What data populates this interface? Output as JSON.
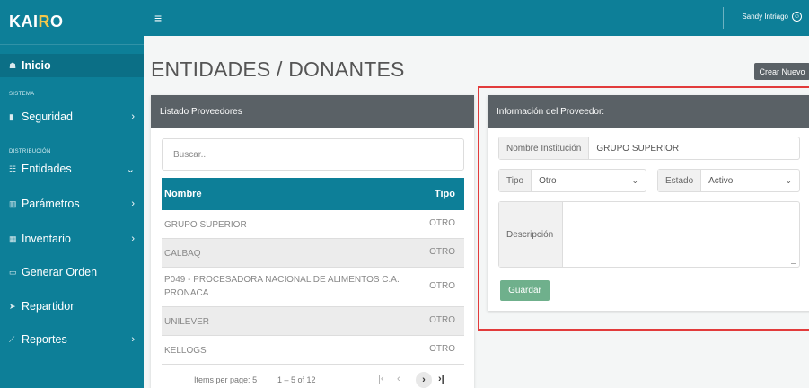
{
  "brand": {
    "prefix": "KAI",
    "accent": "R",
    "suffix": "O"
  },
  "sidebar": {
    "home": "Inicio",
    "sections": [
      "SISTEMA",
      "DISTRIBUCIÓN"
    ],
    "items": [
      {
        "label": "Seguridad",
        "icon": "lock-icon"
      },
      {
        "label": "Entidades",
        "icon": "list-icon"
      },
      {
        "label": "Parámetros",
        "icon": "chart-icon"
      },
      {
        "label": "Inventario",
        "icon": "grid-icon"
      },
      {
        "label": "Generar Orden",
        "icon": "cart-icon"
      },
      {
        "label": "Repartidor",
        "icon": "send-icon"
      },
      {
        "label": "Reportes",
        "icon": "trend-icon"
      }
    ]
  },
  "topbar": {
    "user": "Sandy Intriago"
  },
  "page": {
    "title": "ENTIDADES / DONANTES",
    "create_button": "Crear Nuevo"
  },
  "list": {
    "title": "Listado Proveedores",
    "search_placeholder": "Buscar...",
    "columns": [
      "Nombre",
      "Tipo"
    ],
    "rows": [
      {
        "nombre": "GRUPO SUPERIOR",
        "tipo": "OTRO"
      },
      {
        "nombre": "CALBAQ",
        "tipo": "OTRO"
      },
      {
        "nombre": "P049 - PROCESADORA NACIONAL DE ALIMENTOS C.A. PRONACA",
        "tipo": "OTRO"
      },
      {
        "nombre": "UNILEVER",
        "tipo": "OTRO"
      },
      {
        "nombre": "KELLOGS",
        "tipo": "OTRO"
      }
    ],
    "pager": {
      "per_page_label": "Items per page:",
      "per_page": "5",
      "range": "1 – 5 of 12"
    }
  },
  "form": {
    "title": "Información del Proveedor:",
    "name_label": "Nombre Institución",
    "name_value": "GRUPO SUPERIOR",
    "tipo_label": "Tipo",
    "tipo_value": "Otro",
    "estado_label": "Estado",
    "estado_value": "Activo",
    "desc_label": "Descripción",
    "save": "Guardar"
  },
  "colors": {
    "primary": "#0d7f98",
    "header": "#5a6166",
    "save": "#6fb08c",
    "highlight": "#e23b3b"
  }
}
